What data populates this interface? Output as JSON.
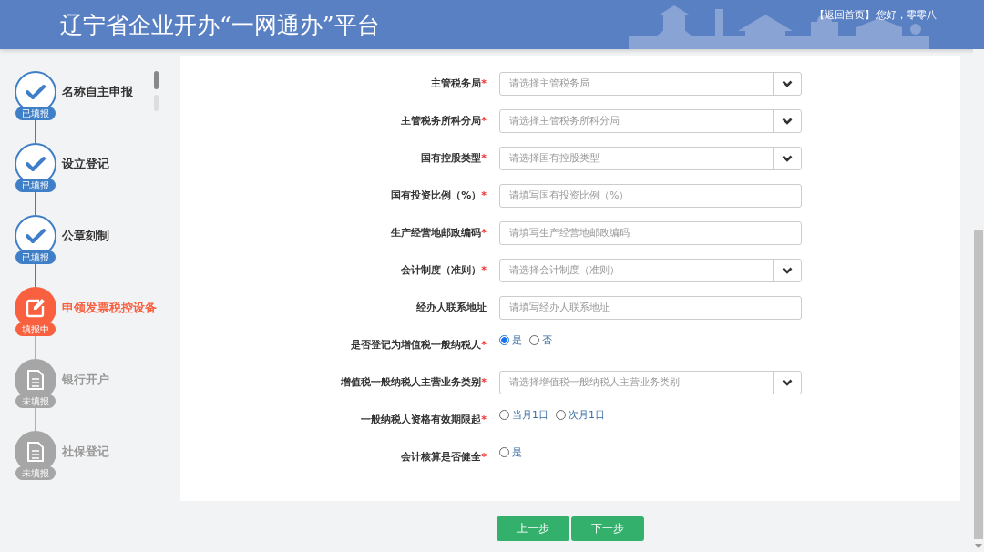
{
  "header": {
    "title": "辽宁省企业开办“一网通办”平台",
    "home_link": "【返回首页】",
    "greeting": "您好，零零八"
  },
  "steps": [
    {
      "label": "名称自主申报",
      "kind": "done",
      "badge": "已填报"
    },
    {
      "label": "设立登记",
      "kind": "done",
      "badge": "已填报"
    },
    {
      "label": "公章刻制",
      "kind": "done",
      "badge": "已填报"
    },
    {
      "label": "申领发票税控设备",
      "kind": "active",
      "badge": "填报中"
    },
    {
      "label": "银行开户",
      "kind": "todo",
      "badge": "未填报"
    },
    {
      "label": "社保登记",
      "kind": "todo",
      "badge": "未填报"
    }
  ],
  "form": [
    {
      "kind": "select",
      "label": "主管税务局",
      "required_mark": "*",
      "placeholder": "请选择主管税务局"
    },
    {
      "kind": "select",
      "label": "主管税务所科分局",
      "required_mark": "*",
      "placeholder": "请选择主管税务所科分局"
    },
    {
      "kind": "select",
      "label": "国有控股类型",
      "required_mark": "*",
      "placeholder": "请选择国有控股类型"
    },
    {
      "kind": "input",
      "label": "国有投资比例（%）",
      "required_mark": "*",
      "placeholder": "请填写国有投资比例（%）"
    },
    {
      "kind": "input",
      "label": "生产经营地邮政编码",
      "required_mark": "*",
      "placeholder": "请填写生产经营地邮政编码"
    },
    {
      "kind": "select",
      "label": "会计制度（准则）",
      "required_mark": "*",
      "placeholder": "请选择会计制度（准则）"
    },
    {
      "kind": "input",
      "label": "经办人联系地址",
      "placeholder": "请填写经办人联系地址"
    },
    {
      "kind": "radio",
      "label": "是否登记为增值税一般纳税人",
      "required_mark": "*",
      "options": [
        {
          "label": "是",
          "selected": true
        },
        {
          "label": "否",
          "selected": false
        }
      ]
    },
    {
      "kind": "select",
      "label": "增值税一般纳税人主营业务类别",
      "required_mark": "*",
      "placeholder": "请选择增值税一般纳税人主营业务类别"
    },
    {
      "kind": "radio",
      "label": "一般纳税人资格有效期限起",
      "required_mark": "*",
      "options": [
        {
          "label": "当月1日",
          "selected": false
        },
        {
          "label": "次月1日",
          "selected": false
        }
      ]
    },
    {
      "kind": "radio",
      "label": "会计核算是否健全",
      "required_mark": "*",
      "options": [
        {
          "label": "是",
          "selected": false
        }
      ]
    }
  ],
  "buttons": [
    "上一步",
    "下一步"
  ]
}
